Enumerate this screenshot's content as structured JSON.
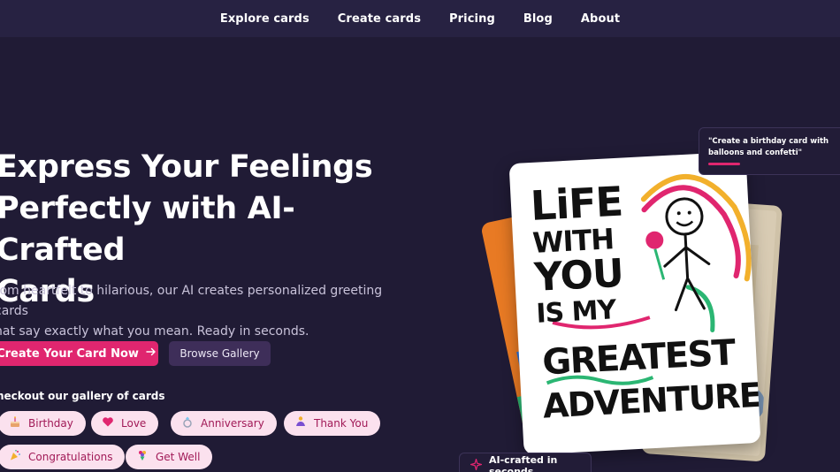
{
  "nav": {
    "items": [
      "Explore cards",
      "Create cards",
      "Pricing",
      "Blog",
      "About"
    ]
  },
  "hero": {
    "title_line1": "Express Your Feelings",
    "title_line2": "Perfectly with AI-Crafted",
    "title_line3": "Cards",
    "subtitle_line1": "rom heartfelt to hilarious, our AI creates personalized greeting cards",
    "subtitle_line2": "hat say exactly what you mean. Ready in seconds.",
    "primary_button": "Create Your Card Now",
    "primary_button_icon": "arrow-right-icon",
    "secondary_button": "Browse Gallery"
  },
  "gallery": {
    "label": "heckout our gallery of cards",
    "chips": [
      {
        "label": "Birthday",
        "icon": "cake-icon"
      },
      {
        "label": "Love",
        "icon": "heart-icon"
      },
      {
        "label": "Anniversary",
        "icon": "ring-icon"
      },
      {
        "label": "Thank You",
        "icon": "praying-hands-icon"
      },
      {
        "label": "Congratulations",
        "icon": "party-popper-icon"
      },
      {
        "label": "Get Well",
        "icon": "bouquet-icon"
      }
    ]
  },
  "showcase": {
    "prompt": "\"Create a birthday card with balloons and confetti\"",
    "card_lines": [
      "LiFE",
      "WITH",
      "YOU",
      "IS MY",
      "GREATEST",
      "ADVENTURE."
    ],
    "ai_badge": "AI-crafted in seconds"
  },
  "colors": {
    "background": "#201b35",
    "nav_bg": "#272242",
    "accent": "#e0266f",
    "secondary_button": "#3e2e59",
    "chip_bg": "#fbe1ee"
  }
}
